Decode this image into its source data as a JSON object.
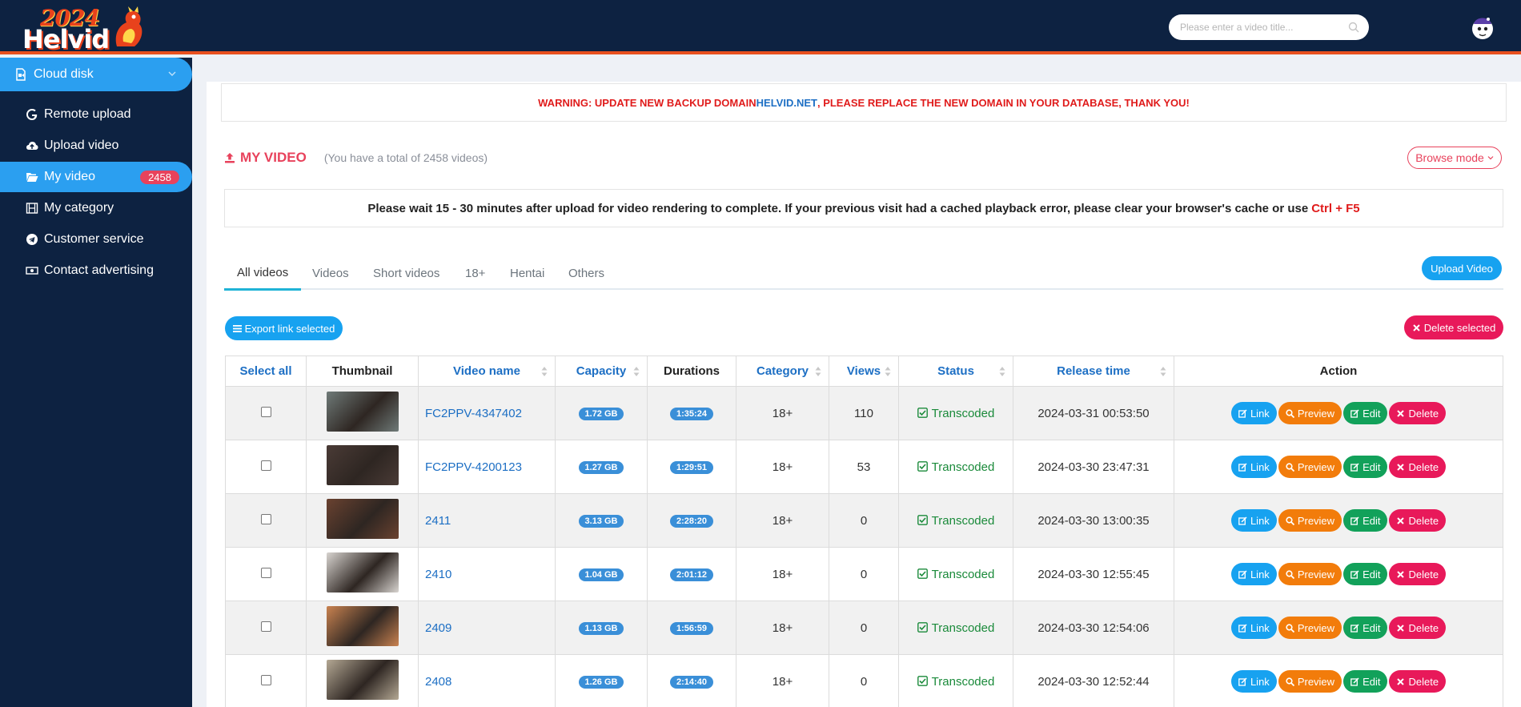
{
  "logo": {
    "year": "2024",
    "brand": "Helvid"
  },
  "search": {
    "placeholder": "Please enter a video title..."
  },
  "sidebar": {
    "top": {
      "label": "Cloud disk"
    },
    "items": [
      {
        "label": "Remote upload",
        "icon": "google-icon"
      },
      {
        "label": "Upload video",
        "icon": "cloud-upload-icon"
      },
      {
        "label": "My video",
        "icon": "folder-open-icon",
        "badge": "2458",
        "active": true
      },
      {
        "label": "My category",
        "icon": "film-icon"
      },
      {
        "label": "Customer service",
        "icon": "telegram-icon"
      },
      {
        "label": "Contact advertising",
        "icon": "money-icon"
      }
    ]
  },
  "warning": {
    "prefix": "WARNING: UPDATE NEW BACKUP DOMAIN ",
    "domain": "HELVID.NET",
    "suffix": ", PLEASE REPLACE THE NEW DOMAIN IN YOUR DATABASE, THANK YOU!"
  },
  "page": {
    "title": "MY VIDEO",
    "total": "(You have a total of 2458 videos)",
    "browse_mode": "Browse mode"
  },
  "notice": {
    "text": "Please wait 15 - 30 minutes after upload for video rendering to complete. If your previous visit had a cached playback error, please clear your browser's cache or use",
    "key": "Ctrl + F5"
  },
  "tabs": [
    "All videos",
    "Videos",
    "Short videos",
    "18+",
    "Hentai",
    "Others"
  ],
  "buttons": {
    "upload_video": "Upload Video",
    "export_link": "Export link selected",
    "delete_selected": "Delete selected"
  },
  "table": {
    "headers": [
      "Select all",
      "Thumbnail",
      "Video name",
      "Capacity",
      "Durations",
      "Category",
      "Views",
      "Status",
      "Release time",
      "Action"
    ],
    "actions": [
      "Link",
      "Preview",
      "Edit",
      "Delete"
    ],
    "rows": [
      {
        "name": "FC2PPV-4347402",
        "capacity": "1.72 GB",
        "duration": "1:35:24",
        "category": "18+",
        "views": "110",
        "status": "Transcoded",
        "release": "2024-03-31 00:53:50",
        "thumb_color": "#6f7a78"
      },
      {
        "name": "FC2PPV-4200123",
        "capacity": "1.27 GB",
        "duration": "1:29:51",
        "category": "18+",
        "views": "53",
        "status": "Transcoded",
        "release": "2024-03-30 23:47:31",
        "thumb_color": "#4a3b36"
      },
      {
        "name": "2411",
        "capacity": "3.13 GB",
        "duration": "2:28:20",
        "category": "18+",
        "views": "0",
        "status": "Transcoded",
        "release": "2024-03-30 13:00:35",
        "thumb_color": "#6a4230"
      },
      {
        "name": "2410",
        "capacity": "1.04 GB",
        "duration": "2:01:12",
        "category": "18+",
        "views": "0",
        "status": "Transcoded",
        "release": "2024-03-30 12:55:45",
        "thumb_color": "#d8d4d0"
      },
      {
        "name": "2409",
        "capacity": "1.13 GB",
        "duration": "1:56:59",
        "category": "18+",
        "views": "0",
        "status": "Transcoded",
        "release": "2024-03-30 12:54:06",
        "thumb_color": "#c98250"
      },
      {
        "name": "2408",
        "capacity": "1.26 GB",
        "duration": "2:14:40",
        "category": "18+",
        "views": "0",
        "status": "Transcoded",
        "release": "2024-03-30 12:52:44",
        "thumb_color": "#b4a894"
      }
    ]
  }
}
